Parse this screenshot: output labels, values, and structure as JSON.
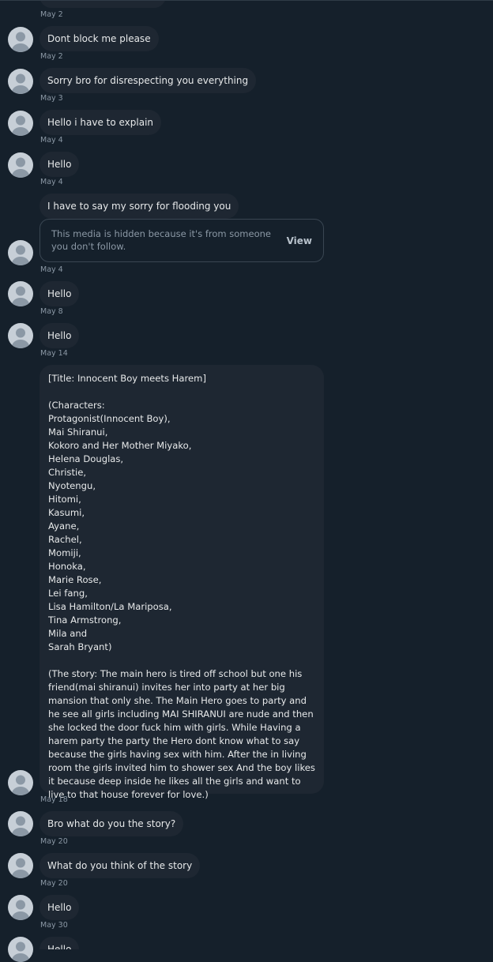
{
  "messages": [
    {
      "text": "Dont block me please",
      "date": "May 2"
    },
    {
      "text": "Sorry bro for disrespecting you everything",
      "date": "May 3"
    },
    {
      "text": "Hello i have to explain",
      "date": "May 4"
    },
    {
      "text": "Hello",
      "date": "May 4"
    },
    {
      "text": "I have to say my sorry for flooding you",
      "date": "May 4"
    },
    {
      "text": "Hello",
      "date": "May 8"
    },
    {
      "text": "Hello",
      "date": "May 14"
    },
    {
      "text": "Bro what do you the story?",
      "date": "May 20"
    },
    {
      "text": "What do you think of the story",
      "date": "May 20"
    },
    {
      "text": "Hello",
      "date": "May 30"
    },
    {
      "text": "Hello",
      "date": ""
    }
  ],
  "top_date": "May 2",
  "hidden_media": {
    "text": "This media is hidden because it's from someone you don't follow.",
    "view_label": "View"
  },
  "story": {
    "title": "[Title: Innocent Boy meets Harem]",
    "characters_header": "(Characters:",
    "characters": [
      "Protagonist(Innocent Boy),",
      "Mai Shiranui,",
      "Kokoro and Her Mother Miyako,",
      "Helena Douglas,",
      "Christie,",
      "Nyotengu,",
      "Hitomi,",
      "Kasumi,",
      "Ayane,",
      "Rachel,",
      "Momiji,",
      "Honoka,",
      "Marie Rose,",
      "Lei fang,",
      "Lisa Hamilton/La Mariposa,",
      "Tina Armstrong,",
      "Mila and",
      "Sarah Bryant)"
    ],
    "plot": "(The story: The main hero is tired off school but one his friend(mai shiranui) invites her into party at her big mansion that only she. The Main Hero goes to party and he see all girls including MAI SHIRANUI are nude and then she locked the door fuck him with girls. While Having a harem party the party the Hero dont know what to say because the girls having sex with him. After the in living room the girls invited him to shower sex And the boy likes it because deep inside he likes all the girls and want to live to that house forever for love.)",
    "date": "May 18"
  }
}
